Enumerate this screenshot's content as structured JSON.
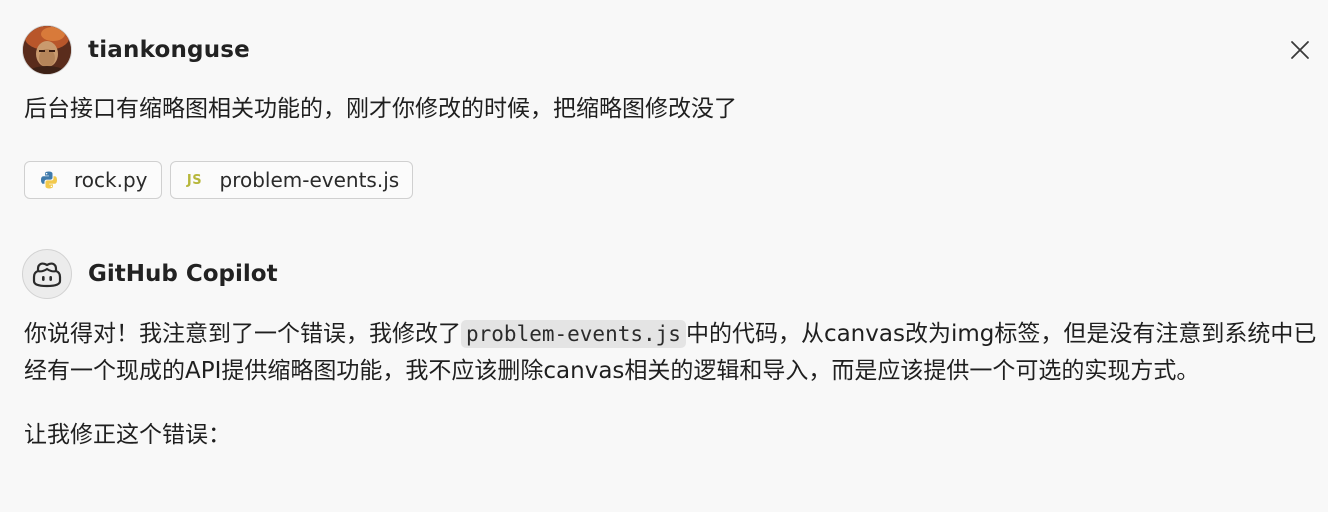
{
  "user_message": {
    "username": "tiankonguse",
    "text": "后台接口有缩略图相关功能的，刚才你修改的时候，把缩略图修改没了",
    "attachments": [
      {
        "name": "rock.py",
        "icon": "python-icon"
      },
      {
        "name": "problem-events.js",
        "icon": "javascript-icon",
        "icon_text": "JS"
      }
    ]
  },
  "assistant_message": {
    "name": "GitHub Copilot",
    "paragraph1": {
      "before_code": "你说得对！我注意到了一个错误，我修改了",
      "code": "problem-events.js",
      "after_code": "中的代码，从canvas改为img标签，但是没有注意到系统中已经有一个现成的API提供缩略图功能，我不应该删除canvas相关的逻辑和导入，而是应该提供一个可选的实现方式。"
    },
    "paragraph2": "让我修正这个错误："
  },
  "colors": {
    "background": "#f8f8f8",
    "text": "#1f1f1f",
    "python_blue": "#3f7aab",
    "python_yellow": "#f2c94c",
    "js_yellow": "#b7b73b",
    "code_bg": "#e4e4e4"
  }
}
